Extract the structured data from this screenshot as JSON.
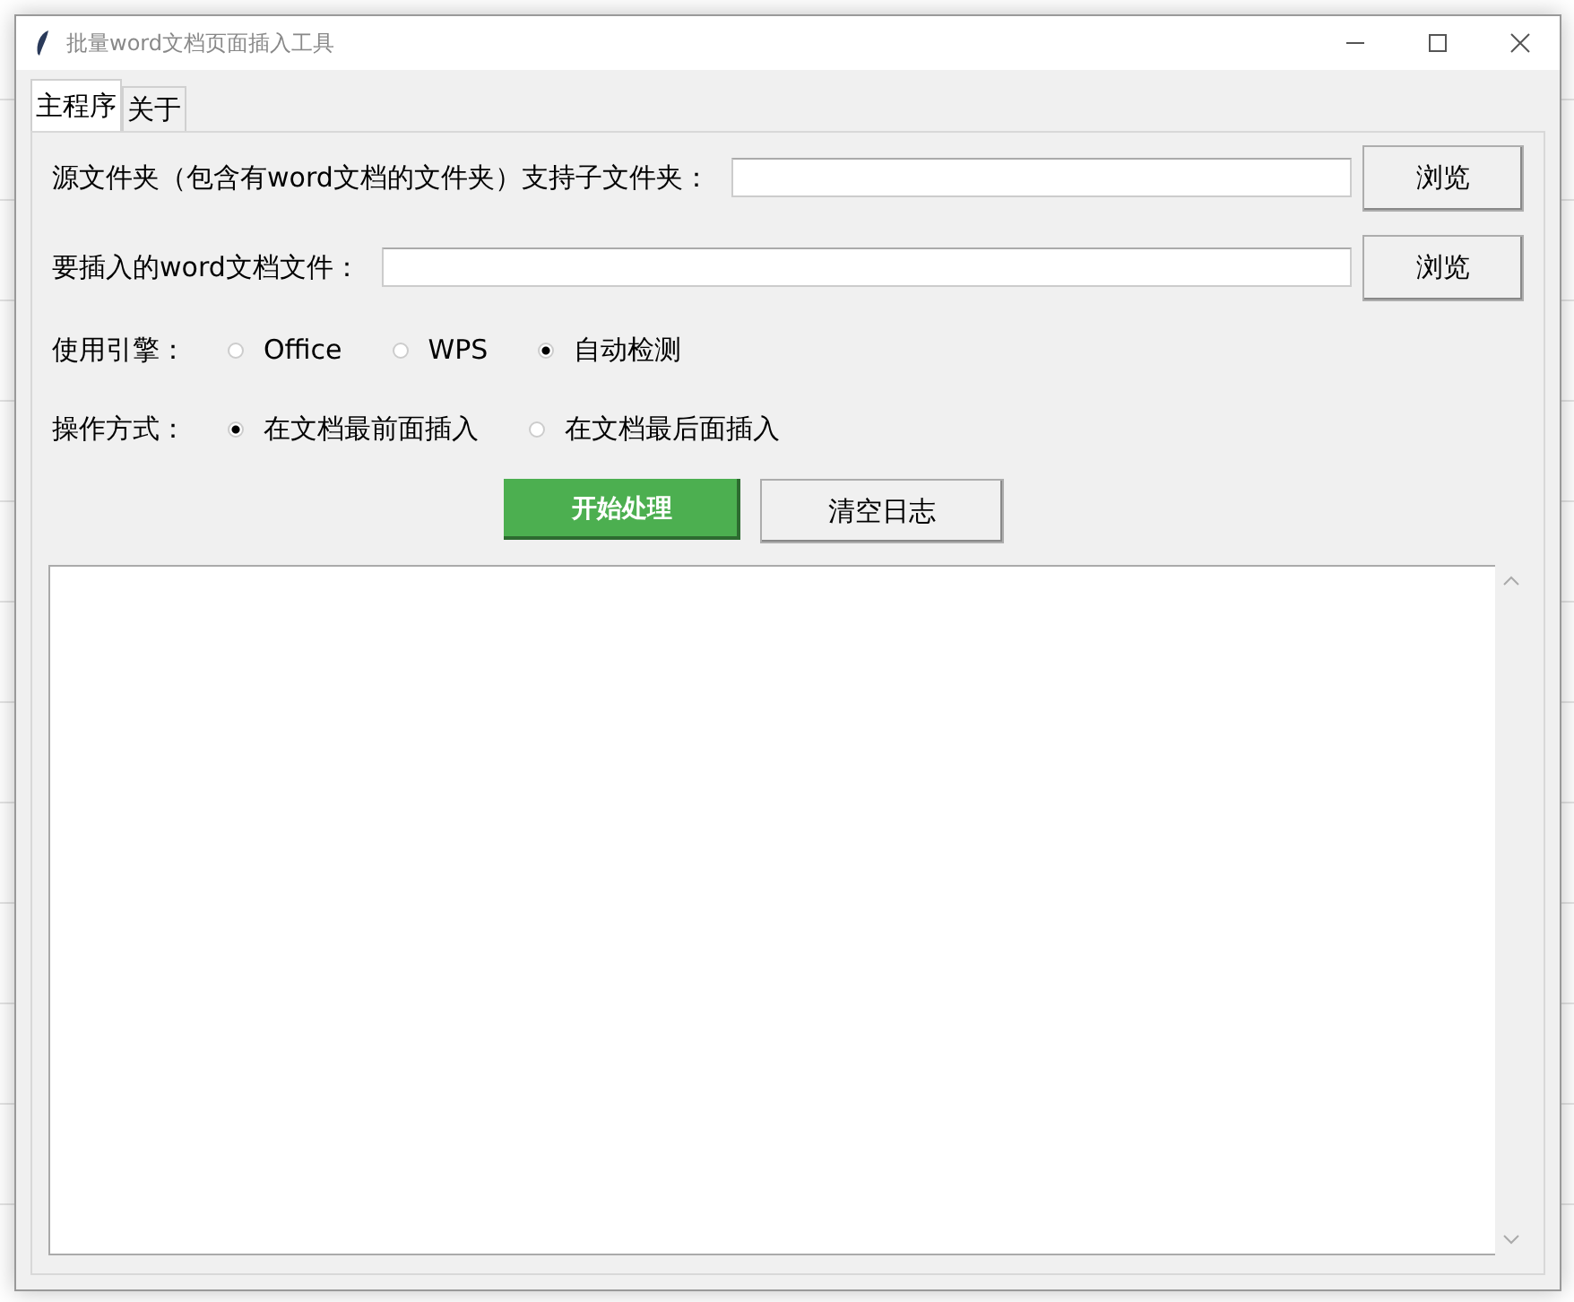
{
  "window": {
    "title": "批量word文档页面插入工具"
  },
  "tabs": [
    {
      "label": "主程序",
      "selected": true
    },
    {
      "label": "关于",
      "selected": false
    }
  ],
  "source_folder": {
    "label": "源文件夹（包含有word文档的文件夹）支持子文件夹：",
    "browse": "浏览"
  },
  "insert_file": {
    "label": "要插入的word文档文件：",
    "browse": "浏览"
  },
  "engine": {
    "label": "使用引擎：",
    "options": [
      {
        "label": "Office",
        "selected": false
      },
      {
        "label": "WPS",
        "selected": false
      },
      {
        "label": "自动检测",
        "selected": true
      }
    ]
  },
  "mode": {
    "label": "操作方式：",
    "options": [
      {
        "label": "在文档最前面插入",
        "selected": true
      },
      {
        "label": "在文档最后面插入",
        "selected": false
      }
    ]
  },
  "buttons": [
    {
      "label": "开始处理",
      "kind": "primary"
    },
    {
      "label": "清空日志",
      "kind": "normal"
    }
  ]
}
